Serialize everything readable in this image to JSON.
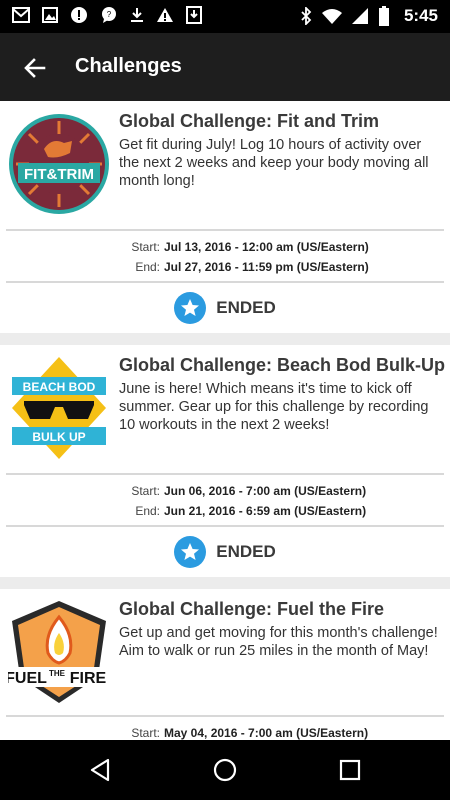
{
  "status_bar": {
    "time": "5:45",
    "left_icons": [
      "gmail-icon",
      "image-icon",
      "alert-icon",
      "chat-icon",
      "download-icon",
      "warning-icon",
      "download-box-icon"
    ],
    "right_icons": [
      "bluetooth-icon",
      "wifi-icon",
      "signal-icon",
      "battery-icon"
    ]
  },
  "header": {
    "title": "Challenges"
  },
  "challenges": [
    {
      "title": "Global Challenge: Fit and Trim",
      "description": "Get fit during July! Log 10 hours of activity over the next 2 weeks and keep your body moving all month long!",
      "start_label": "Start:",
      "start": "Jul 13, 2016 - 12:00 am (US/Eastern)",
      "end_label": "End:",
      "end": "Jul 27, 2016 - 11:59 pm (US/Eastern)",
      "status": "ENDED",
      "logo_text": "FIT&TRIM"
    },
    {
      "title": "Global Challenge: Beach Bod Bulk-Up",
      "description": "June is here! Which means it's time to kick off summer. Gear up for this challenge by recording 10 workouts in the next 2 weeks!",
      "start_label": "Start:",
      "start": "Jun 06, 2016 - 7:00 am (US/Eastern)",
      "end_label": "End:",
      "end": "Jun 21, 2016 - 6:59 am (US/Eastern)",
      "status": "ENDED",
      "logo_text_top": "BEACH BOD",
      "logo_text_bottom": "BULK UP"
    },
    {
      "title": "Global Challenge: Fuel the Fire",
      "description": "Get up and get moving for this month's challenge! Aim to walk or run 25 miles in the month of May!",
      "start_label": "Start:",
      "start": "May 04, 2016 - 7:00 am (US/Eastern)",
      "logo_text_left": "FUEL",
      "logo_text_mid": "THE",
      "logo_text_right": "FIRE"
    }
  ],
  "colors": {
    "accent": "#2b9be0",
    "appbar": "#1e1e1e"
  }
}
